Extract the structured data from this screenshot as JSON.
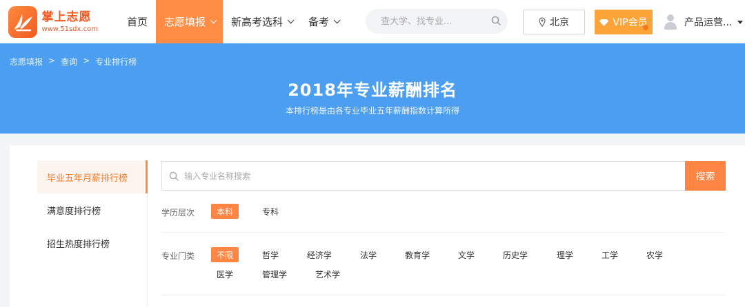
{
  "logo": {
    "title": "掌上志愿",
    "url": "www.51sdx.com"
  },
  "nav": [
    {
      "label": "首页",
      "dropdown": false,
      "active": false
    },
    {
      "label": "志愿填报",
      "dropdown": true,
      "active": true
    },
    {
      "label": "新高考选科",
      "dropdown": true,
      "active": false
    },
    {
      "label": "备考",
      "dropdown": true,
      "active": false
    }
  ],
  "top_search": {
    "placeholder": "查大学、找专业..."
  },
  "city": "北京",
  "vip": "VIP会员",
  "user": "产品运营...",
  "breadcrumb": [
    "志愿填报",
    ">",
    "查询",
    ">",
    "专业排行榜"
  ],
  "banner": {
    "title": "2018年专业薪酬排名",
    "subtitle": "本排行榜是由各专业毕业五年薪酬指数计算所得"
  },
  "sidebar": [
    {
      "label": "毕业五年月薪排行榜",
      "active": true
    },
    {
      "label": "满意度排行榜",
      "active": false
    },
    {
      "label": "招生热度排行榜",
      "active": false
    }
  ],
  "search": {
    "placeholder": "输入专业名称搜索",
    "button": "搜索"
  },
  "filters": {
    "level": {
      "label": "学历层次",
      "options": [
        "本科",
        "专科"
      ],
      "selected": "本科"
    },
    "category": {
      "label": "专业门类",
      "options": [
        "不限",
        "哲学",
        "经济学",
        "法学",
        "教育学",
        "文学",
        "历史学",
        "理学",
        "工学",
        "农学",
        "医学",
        "管理学",
        "艺术学"
      ],
      "selected": "不限"
    }
  },
  "colors": {
    "accent": "#ff8544",
    "banner": "#4b9ef0",
    "vip": "#fba538"
  }
}
